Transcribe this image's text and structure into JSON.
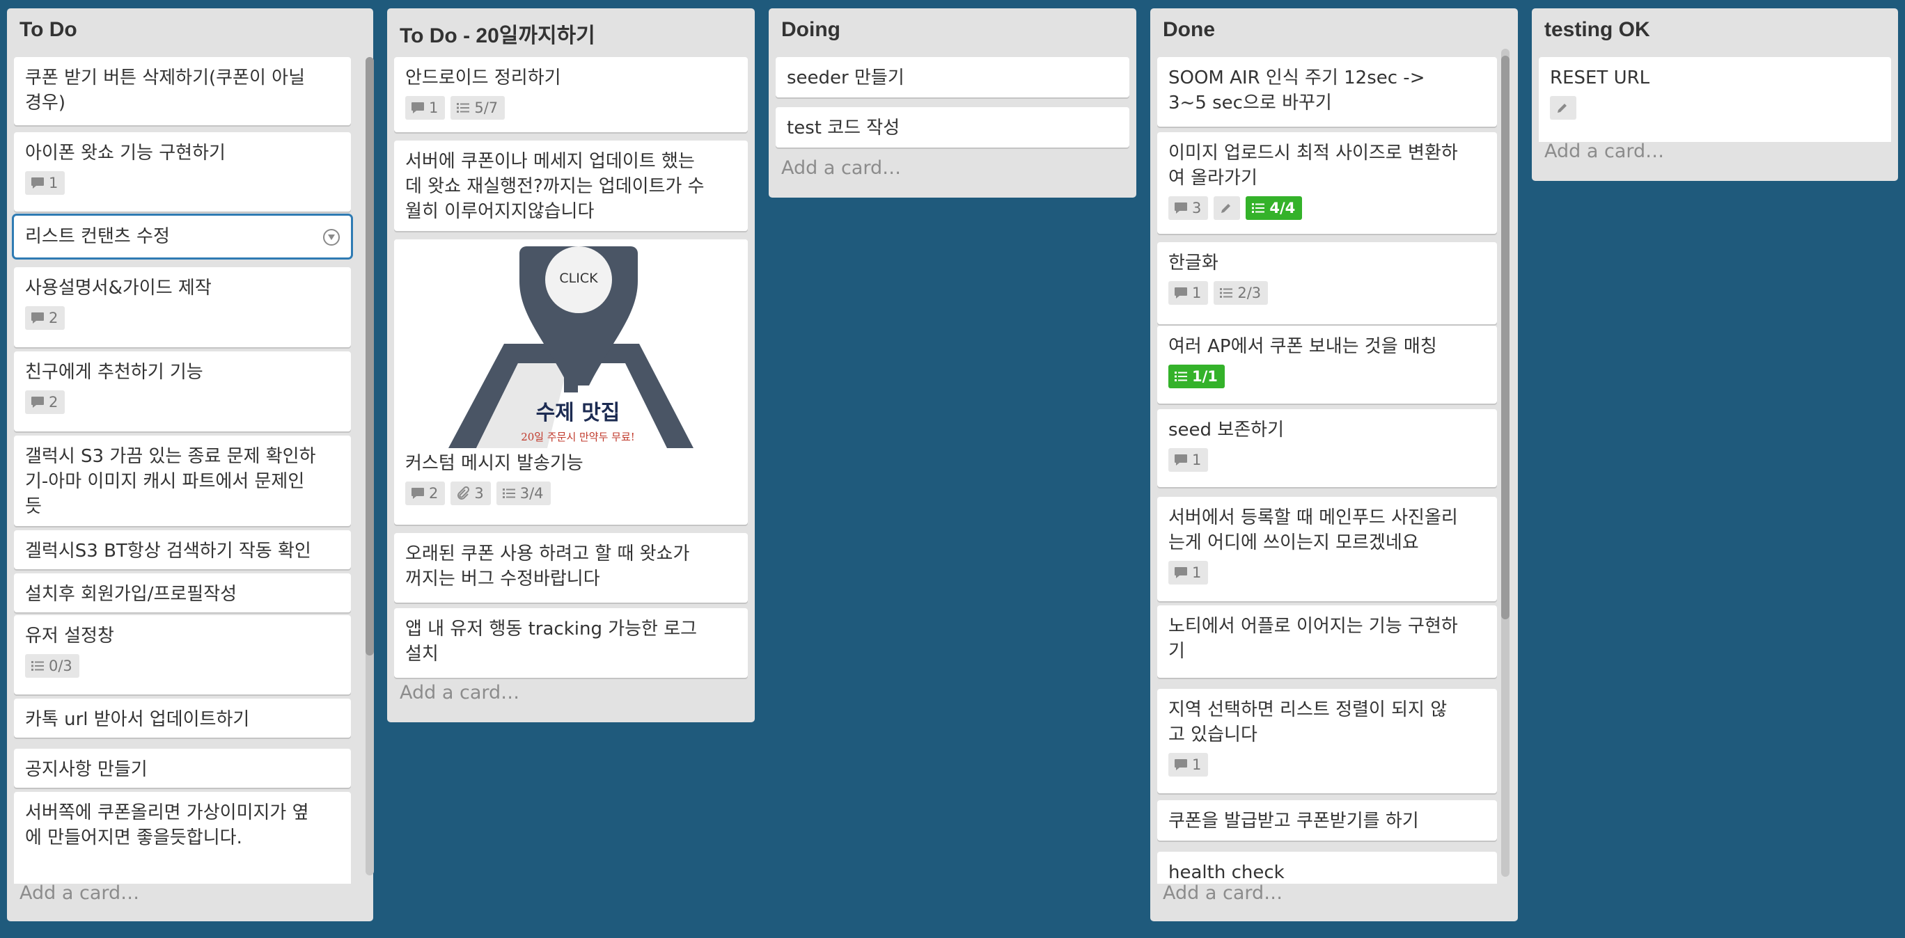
{
  "lists": [
    {
      "title": "To Do",
      "add_card": "Add a card…",
      "cards": [
        {
          "text": [
            "쿠폰 받기 버튼 삭제하기(쿠폰이 아닐",
            "경우)"
          ]
        },
        {
          "text": [
            "아이폰 왓쇼 기능 구현하기"
          ],
          "badges": [
            {
              "icon": "comment-icon",
              "value": "1"
            }
          ]
        },
        {
          "text": [
            "리스트 컨탠츠 수정"
          ],
          "active": true
        },
        {
          "text": [
            "사용설명서&가이드 제작"
          ],
          "badges": [
            {
              "icon": "comment-icon",
              "value": "2"
            }
          ]
        },
        {
          "text": [
            "친구에게 추천하기 기능"
          ],
          "badges": [
            {
              "icon": "comment-icon",
              "value": "2"
            }
          ]
        },
        {
          "text": [
            "갤럭시 S3 가끔 있는 종료 문제 확인하",
            "기-아마 이미지 캐시 파트에서 문제인",
            "듯"
          ]
        },
        {
          "text": [
            "겔럭시S3 BT항상 검색하기 작동 확인"
          ]
        },
        {
          "text": [
            "설치후 회원가입/프로필작성"
          ]
        },
        {
          "text": [
            "유저 설정창"
          ],
          "badges": [
            {
              "icon": "checklist-icon",
              "value": "0/3"
            }
          ]
        },
        {
          "text": [
            "카톡 url 받아서 업데이트하기"
          ]
        },
        {
          "text": [
            "공지사항 만들기"
          ]
        },
        {
          "text": [
            "서버쪽에 쿠폰올리면 가상이미지가 옆",
            "에 만들어지면 좋을듯합니다."
          ]
        }
      ]
    },
    {
      "title": "To Do - 20일까지하기",
      "add_card": "Add a card…",
      "cards": [
        {
          "text": [
            "안드로이드 정리하기"
          ],
          "badges": [
            {
              "icon": "comment-icon",
              "value": "1"
            },
            {
              "icon": "checklist-icon",
              "value": "5/7"
            }
          ]
        },
        {
          "text": [
            "서버에 쿠폰이나 메세지 업데이트 했는",
            "데 왓쇼 재실행전?까지는 업데이트가 수",
            "월히 이루어지지않습니다"
          ]
        },
        {
          "text": [
            "커스텀 메시지 발송기능"
          ],
          "cover": {
            "click": "CLICK",
            "title": "수제 맛집",
            "subtitle": "20일 주문시 만약두 무료!"
          },
          "badges": [
            {
              "icon": "comment-icon",
              "value": "2"
            },
            {
              "icon": "attachment-icon",
              "value": "3"
            },
            {
              "icon": "checklist-icon",
              "value": "3/4"
            }
          ]
        },
        {
          "text": [
            "오래된 쿠폰 사용 하려고 할 때 왓쇼가",
            "꺼지는 버그 수정바랍니다"
          ]
        },
        {
          "text": [
            "앱 내 유저 행동 tracking 가능한 로그",
            "설치"
          ]
        }
      ]
    },
    {
      "title": "Doing",
      "add_card": "Add a card…",
      "cards": [
        {
          "text": [
            "seeder 만들기"
          ]
        },
        {
          "text": [
            "test 코드 작성"
          ]
        }
      ]
    },
    {
      "title": "Done",
      "add_card": "Add a card…",
      "cards": [
        {
          "text": [
            "SOOM AIR 인식 주기 12sec ->",
            "3~5 sec으로 바꾸기"
          ]
        },
        {
          "text": [
            "이미지 업로드시 최적 사이즈로 변환하",
            "여 올라가기"
          ],
          "badges": [
            {
              "icon": "comment-icon",
              "value": "3"
            },
            {
              "icon": "pencil-icon",
              "value": ""
            },
            {
              "icon": "checklist-icon",
              "value": "4/4",
              "complete": true
            }
          ]
        },
        {
          "text": [
            "한글화"
          ],
          "badges": [
            {
              "icon": "comment-icon",
              "value": "1"
            },
            {
              "icon": "checklist-icon",
              "value": "2/3"
            }
          ]
        },
        {
          "text": [
            "여러 AP에서 쿠폰 보내는 것을 매칭"
          ],
          "badges": [
            {
              "icon": "checklist-icon",
              "value": "1/1",
              "complete": true
            }
          ]
        },
        {
          "text": [
            "seed 보존하기"
          ],
          "badges": [
            {
              "icon": "comment-icon",
              "value": "1"
            }
          ]
        },
        {
          "text": [
            "서버에서 등록할 때 메인푸드 사진올리",
            "는게 어디에 쓰이는지 모르겠네요"
          ],
          "badges": [
            {
              "icon": "comment-icon",
              "value": "1"
            }
          ]
        },
        {
          "text": [
            "노티에서 어플로 이어지는 기능 구현하",
            "기"
          ]
        },
        {
          "text": [
            "지역 선택하면 리스트 정렬이 되지 않",
            "고 있습니다"
          ],
          "badges": [
            {
              "icon": "comment-icon",
              "value": "1"
            }
          ]
        },
        {
          "text": [
            "쿠폰을 발급받고 쿠폰받기를 하기"
          ]
        },
        {
          "text": [
            "health check"
          ],
          "badges": [
            {
              "icon": "checklist-icon",
              "value": "",
              "complete": true
            }
          ]
        }
      ]
    },
    {
      "title": "testing OK",
      "add_card": "Add a card…",
      "cards": [
        {
          "text": [
            "RESET URL"
          ],
          "badges": [
            {
              "icon": "pencil-icon",
              "value": ""
            }
          ]
        }
      ]
    }
  ]
}
